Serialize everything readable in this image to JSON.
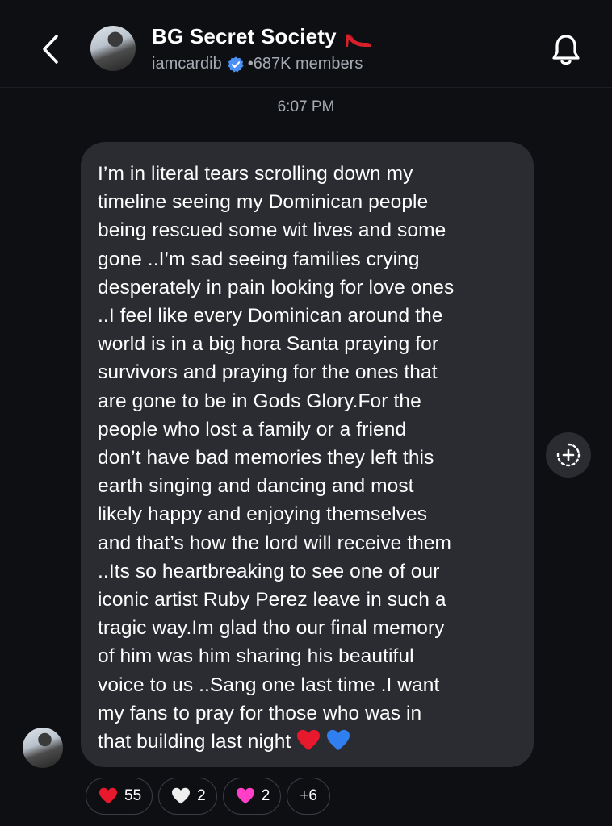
{
  "header": {
    "back_icon": "chevron-left-icon",
    "title": "BG Secret Society",
    "title_emoji": "high-heel-icon",
    "username": "iamcardib",
    "verified_icon": "verified-badge-icon",
    "separator": "•",
    "members": "687K members",
    "bell_icon": "bell-icon"
  },
  "timestamp": "6:07 PM",
  "message": {
    "text": "I’m in literal tears scrolling down my\ntimeline seeing my Dominican people\nbeing rescued some wit lives and some\ngone ..I’m sad seeing families crying\ndesperately in pain looking for love ones\n..I feel like every Dominican around the\nworld is in a big hora Santa praying for\nsurvivors and praying for the ones that\nare gone to be in Gods Glory.For the\npeople who lost a family or a friend\ndon’t have bad memories they left this\nearth singing and dancing and most\nlikely happy and enjoying themselves\nand that’s how the lord will receive them\n..Its so heartbreaking to see one of our\niconic artist Ruby Perez leave in such a\ntragic way.Im glad tho our final memory\nof him was him sharing his beautiful\nvoice to us ..Sang one last time .I want\nmy fans to pray for those who was in\nthat building last night",
    "trailing_emojis": [
      "red-heart-icon",
      "blue-heart-icon"
    ],
    "share_icon": "add-reaction-icon"
  },
  "reactions": [
    {
      "icon": "red-heart-icon",
      "color": "#e8192c",
      "count": "55"
    },
    {
      "icon": "white-heart-icon",
      "color": "#eeeeee",
      "count": "2"
    },
    {
      "icon": "pink-heart-icon",
      "color": "#ff3fc8",
      "count": "2"
    },
    {
      "label": "+6"
    }
  ],
  "colors": {
    "background": "#0d0f13",
    "bubble": "#2a2c31",
    "secondary_text": "#a6abb3",
    "verified": "#4a90f5"
  }
}
